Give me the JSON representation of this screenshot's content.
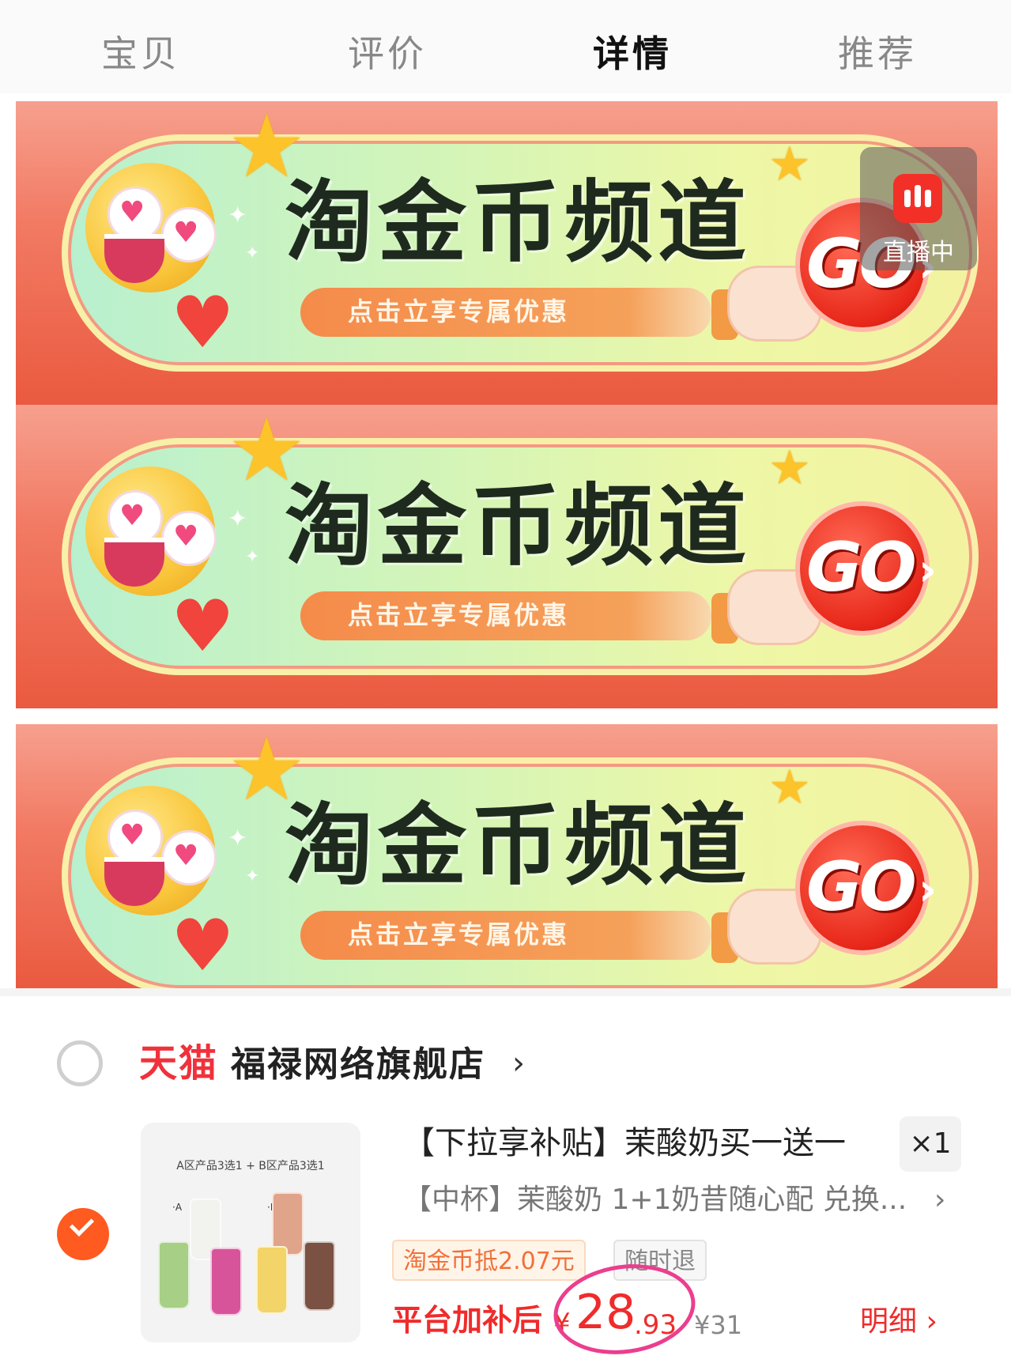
{
  "tabs": [
    {
      "label": "宝贝",
      "active": false
    },
    {
      "label": "评价",
      "active": false
    },
    {
      "label": "详情",
      "active": true
    },
    {
      "label": "推荐",
      "active": false
    }
  ],
  "banners": [
    {
      "title": "淘金币频道",
      "subtitle": "点击立享专属优惠",
      "go": "GO"
    },
    {
      "title": "淘金币频道",
      "subtitle": "点击立享专属优惠",
      "go": "GO"
    },
    {
      "title": "淘金币频道",
      "subtitle": "点击立享专属优惠",
      "go": "GO"
    }
  ],
  "live_badge": {
    "label": "直播中",
    "icon": "live-bars-icon"
  },
  "cart_item": {
    "shop": {
      "brand": "天猫",
      "name": "福禄网络旗舰店",
      "chevron": "›",
      "selected": false
    },
    "selected": true,
    "thumbnail": {
      "caption": "A区产品3选1 + B区产品3选1",
      "tag_a": "·A",
      "tag_b": "·B"
    },
    "title": "【下拉享补贴】茉酸奶买一送一",
    "quantity": "×1",
    "spec": "【中杯】茉酸奶 1+1奶昔随心配 兑换...",
    "tags": [
      "淘金币抵2.07元",
      "随时退"
    ],
    "price_label": "平台加补后",
    "price_currency": "¥",
    "price_integer": "28",
    "price_decimal": ".93",
    "original_price": "¥31",
    "detail_link": "明细 ›"
  },
  "colors": {
    "accent_red": "#f02b2b",
    "brand_orange": "#ff5a1f",
    "banner_red": "#ea5a40",
    "annotation_pink": "#ec3e8e"
  }
}
